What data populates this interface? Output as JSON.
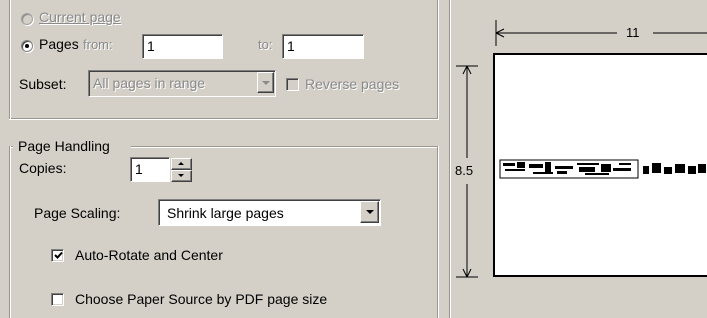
{
  "page_range": {
    "current_page_label": "Current page",
    "pages_label": "Pages",
    "from_label": "from:",
    "from_value": "1",
    "to_label": "to:",
    "to_value": "1",
    "subset_label": "Subset:",
    "subset_value": "All pages in range",
    "reverse_pages_label": "Reverse pages"
  },
  "page_handling": {
    "group_title": "Page Handling",
    "copies_label": "Copies:",
    "copies_value": "1",
    "page_scaling_label": "Page Scaling:",
    "page_scaling_value": "Shrink large pages",
    "auto_rotate_label": "Auto-Rotate and Center",
    "auto_rotate_checked": true,
    "paper_source_label": "Choose Paper Source by PDF page size",
    "paper_source_checked": false
  },
  "preview": {
    "width_label": "11",
    "height_label": "8.5"
  }
}
